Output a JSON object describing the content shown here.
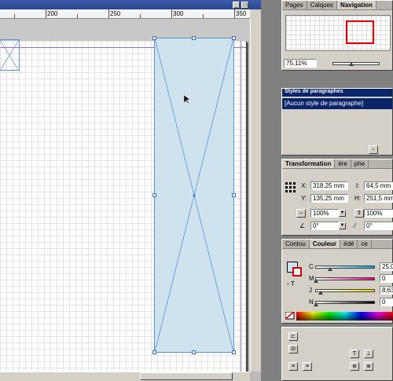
{
  "document": {
    "ruler_labels": [
      "200",
      "250",
      "300",
      "350"
    ]
  },
  "window_buttons": {
    "minimize": "_",
    "restore": "□"
  },
  "pages_panel": {
    "tabs": [
      "Pages",
      "Calques",
      "Navigation"
    ],
    "active_tab": "Navigation",
    "zoom_value": "75,11%"
  },
  "paragraph_styles_panel": {
    "title": "Styles de paragraphes",
    "items": [
      "[Aucun style de paragraphe]"
    ]
  },
  "transformation_panel": {
    "tabs": [
      "Transformation",
      "ère",
      "phe"
    ],
    "x_label": "X:",
    "x_value": "318,25 mm",
    "y_label": "Y:",
    "y_value": "135,25 mm",
    "w_label": "l:",
    "w_value": "64,5 mm",
    "h_label": "H:",
    "h_value": "251,5 mm",
    "scale_x": "100%",
    "scale_y": "100%",
    "rotate": "0°",
    "shear": "0°"
  },
  "color_panel": {
    "tabs": [
      "Contou",
      "Couleur",
      "édé",
      "ce"
    ],
    "active_tab": "Couleur",
    "channels": [
      {
        "label": "C",
        "value": "25,0",
        "color": "#00a0e0"
      },
      {
        "label": "M",
        "value": "0",
        "color": "#e0008a"
      },
      {
        "label": "J",
        "value": "8,63",
        "color": "#e8e000"
      },
      {
        "label": "N",
        "value": "0",
        "color": "#000000"
      }
    ],
    "fill_color": "#cfe3ee"
  },
  "colors": {
    "frame_fill": "#cfe3ee",
    "frame_stroke": "#5b8fd6",
    "selection_handle": "#3a6fcf",
    "panel_title_bg": "#0a246a"
  }
}
